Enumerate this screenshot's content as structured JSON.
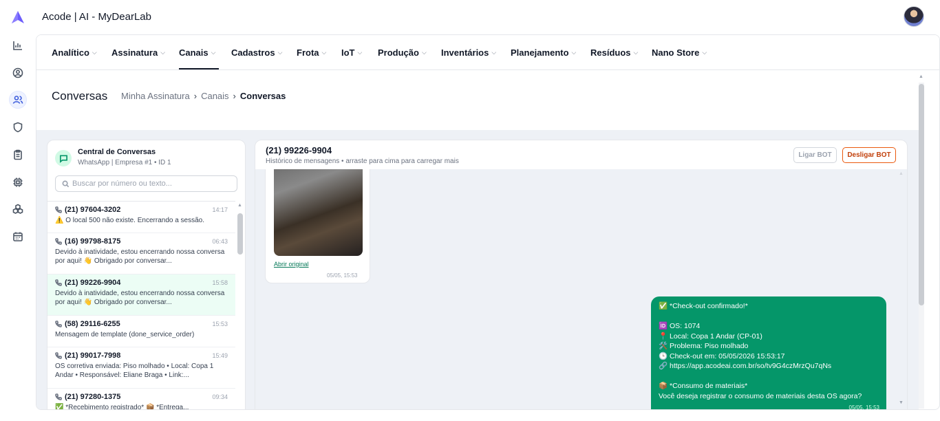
{
  "app": {
    "title": "Acode | AI - MyDearLab",
    "logo_color": "#6d5dfc"
  },
  "sidebar": {
    "icons": [
      {
        "name": "analytics-icon"
      },
      {
        "name": "user-circle-icon"
      },
      {
        "name": "users-icon",
        "active": true
      },
      {
        "name": "shield-icon"
      },
      {
        "name": "clipboard-icon"
      },
      {
        "name": "chip-icon"
      },
      {
        "name": "boxes-icon"
      },
      {
        "name": "calendar-icon"
      }
    ]
  },
  "menu": {
    "items": [
      {
        "label": "Analítico"
      },
      {
        "label": "Assinatura"
      },
      {
        "label": "Canais",
        "active": true
      },
      {
        "label": "Cadastros"
      },
      {
        "label": "Frota"
      },
      {
        "label": "IoT"
      },
      {
        "label": "Produção"
      },
      {
        "label": "Inventários"
      },
      {
        "label": "Planejamento"
      },
      {
        "label": "Resíduos"
      },
      {
        "label": "Nano Store"
      }
    ]
  },
  "page": {
    "title": "Conversas",
    "breadcrumb": [
      "Minha Assinatura",
      "Canais",
      "Conversas"
    ]
  },
  "conversations_panel": {
    "title": "Central de Conversas",
    "subtitle": "WhatsApp | Empresa #1 • ID 1",
    "search_placeholder": "Buscar por número ou texto...",
    "items": [
      {
        "phone": "(21) 97604-3202",
        "time": "14:17",
        "message": "⚠️ O local 500 não existe. Encerrando a sessão."
      },
      {
        "phone": "(16) 99798-8175",
        "time": "06:43",
        "message": "Devido à inatividade, estou encerrando nossa conversa por aqui! 👋 Obrigado por conversar..."
      },
      {
        "phone": "(21) 99226-9904",
        "time": "15:58",
        "message": "Devido à inatividade, estou encerrando nossa conversa por aqui! 👋 Obrigado por conversar...",
        "active": true
      },
      {
        "phone": "(58) 29116-6255",
        "time": "15:53",
        "message": "Mensagem de template (done_service_order)"
      },
      {
        "phone": "(21) 99017-7998",
        "time": "15:49",
        "message": "OS corretiva enviada: Piso molhado • Local: Copa 1 Andar • Responsável: Eliane Braga • Link:..."
      },
      {
        "phone": "(21) 97280-1375",
        "time": "09:34",
        "message": "✅ *Recebimento registrado* 📦 *Entrega..."
      }
    ]
  },
  "chat": {
    "phone": "(21) 99226-9904",
    "hint": "Histórico de mensagens • arraste para cima para carregar mais",
    "buttons": {
      "bot_on": "Ligar BOT",
      "bot_off": "Desligar BOT"
    },
    "image_message": {
      "link": "Abrir original",
      "time": "05/05, 15:53"
    },
    "bot_message": {
      "lines": [
        "✅ *Check-out confirmado!*",
        "",
        "🆔 OS: 1074",
        "📍 Local: Copa 1 Andar (CP-01)",
        "🛠️ Problema: Piso molhado",
        "🕒 Check-out em: 05/05/2026 15:53:17",
        "🔗 https://app.acodeai.com.br/so/tv9G4czMrzQu7qNs",
        "",
        "📦 *Consumo de materiais*",
        "Você deseja registrar o consumo de materiais desta OS agora?"
      ],
      "time": "05/05, 15:53",
      "color": "#059669"
    }
  }
}
